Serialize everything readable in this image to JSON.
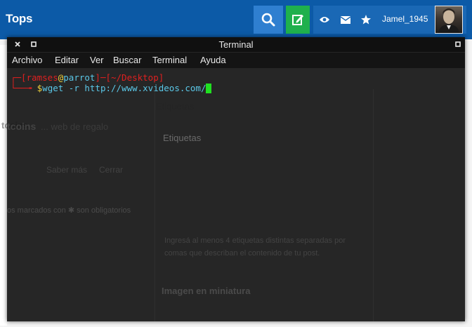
{
  "site": {
    "brand": "Tops",
    "username": "Jamel_1945",
    "colors": {
      "bar": "#0c5aa7",
      "search": "#2f7fd0",
      "new_post": "#1fb04d"
    }
  },
  "background_page": {
    "title_fragment": "tcoins",
    "subtitle_fragment": "... web de regalo",
    "links": [
      "Saber más",
      "Cerrar"
    ],
    "section_tags": "Etiquetas",
    "required_note": "os marcados con ✱ son obligatorios",
    "tags_help_line1": "Ingresá al menos 4 etiquetas distintas separadas por",
    "tags_help_line2": "comas que describan el contenido de tu post.",
    "section_thumb": "Imagen en miniatura"
  },
  "terminal": {
    "title": "Terminal",
    "menu": [
      "Archivo",
      "Editar",
      "Ver",
      "Buscar",
      "Terminal",
      "Ayuda"
    ],
    "prompt": {
      "user": "ramses",
      "at": "@",
      "host": "parrot",
      "dir": "~/Desktop",
      "symbol": "$",
      "command": "wget -r http://www.xvideos.com/"
    }
  }
}
